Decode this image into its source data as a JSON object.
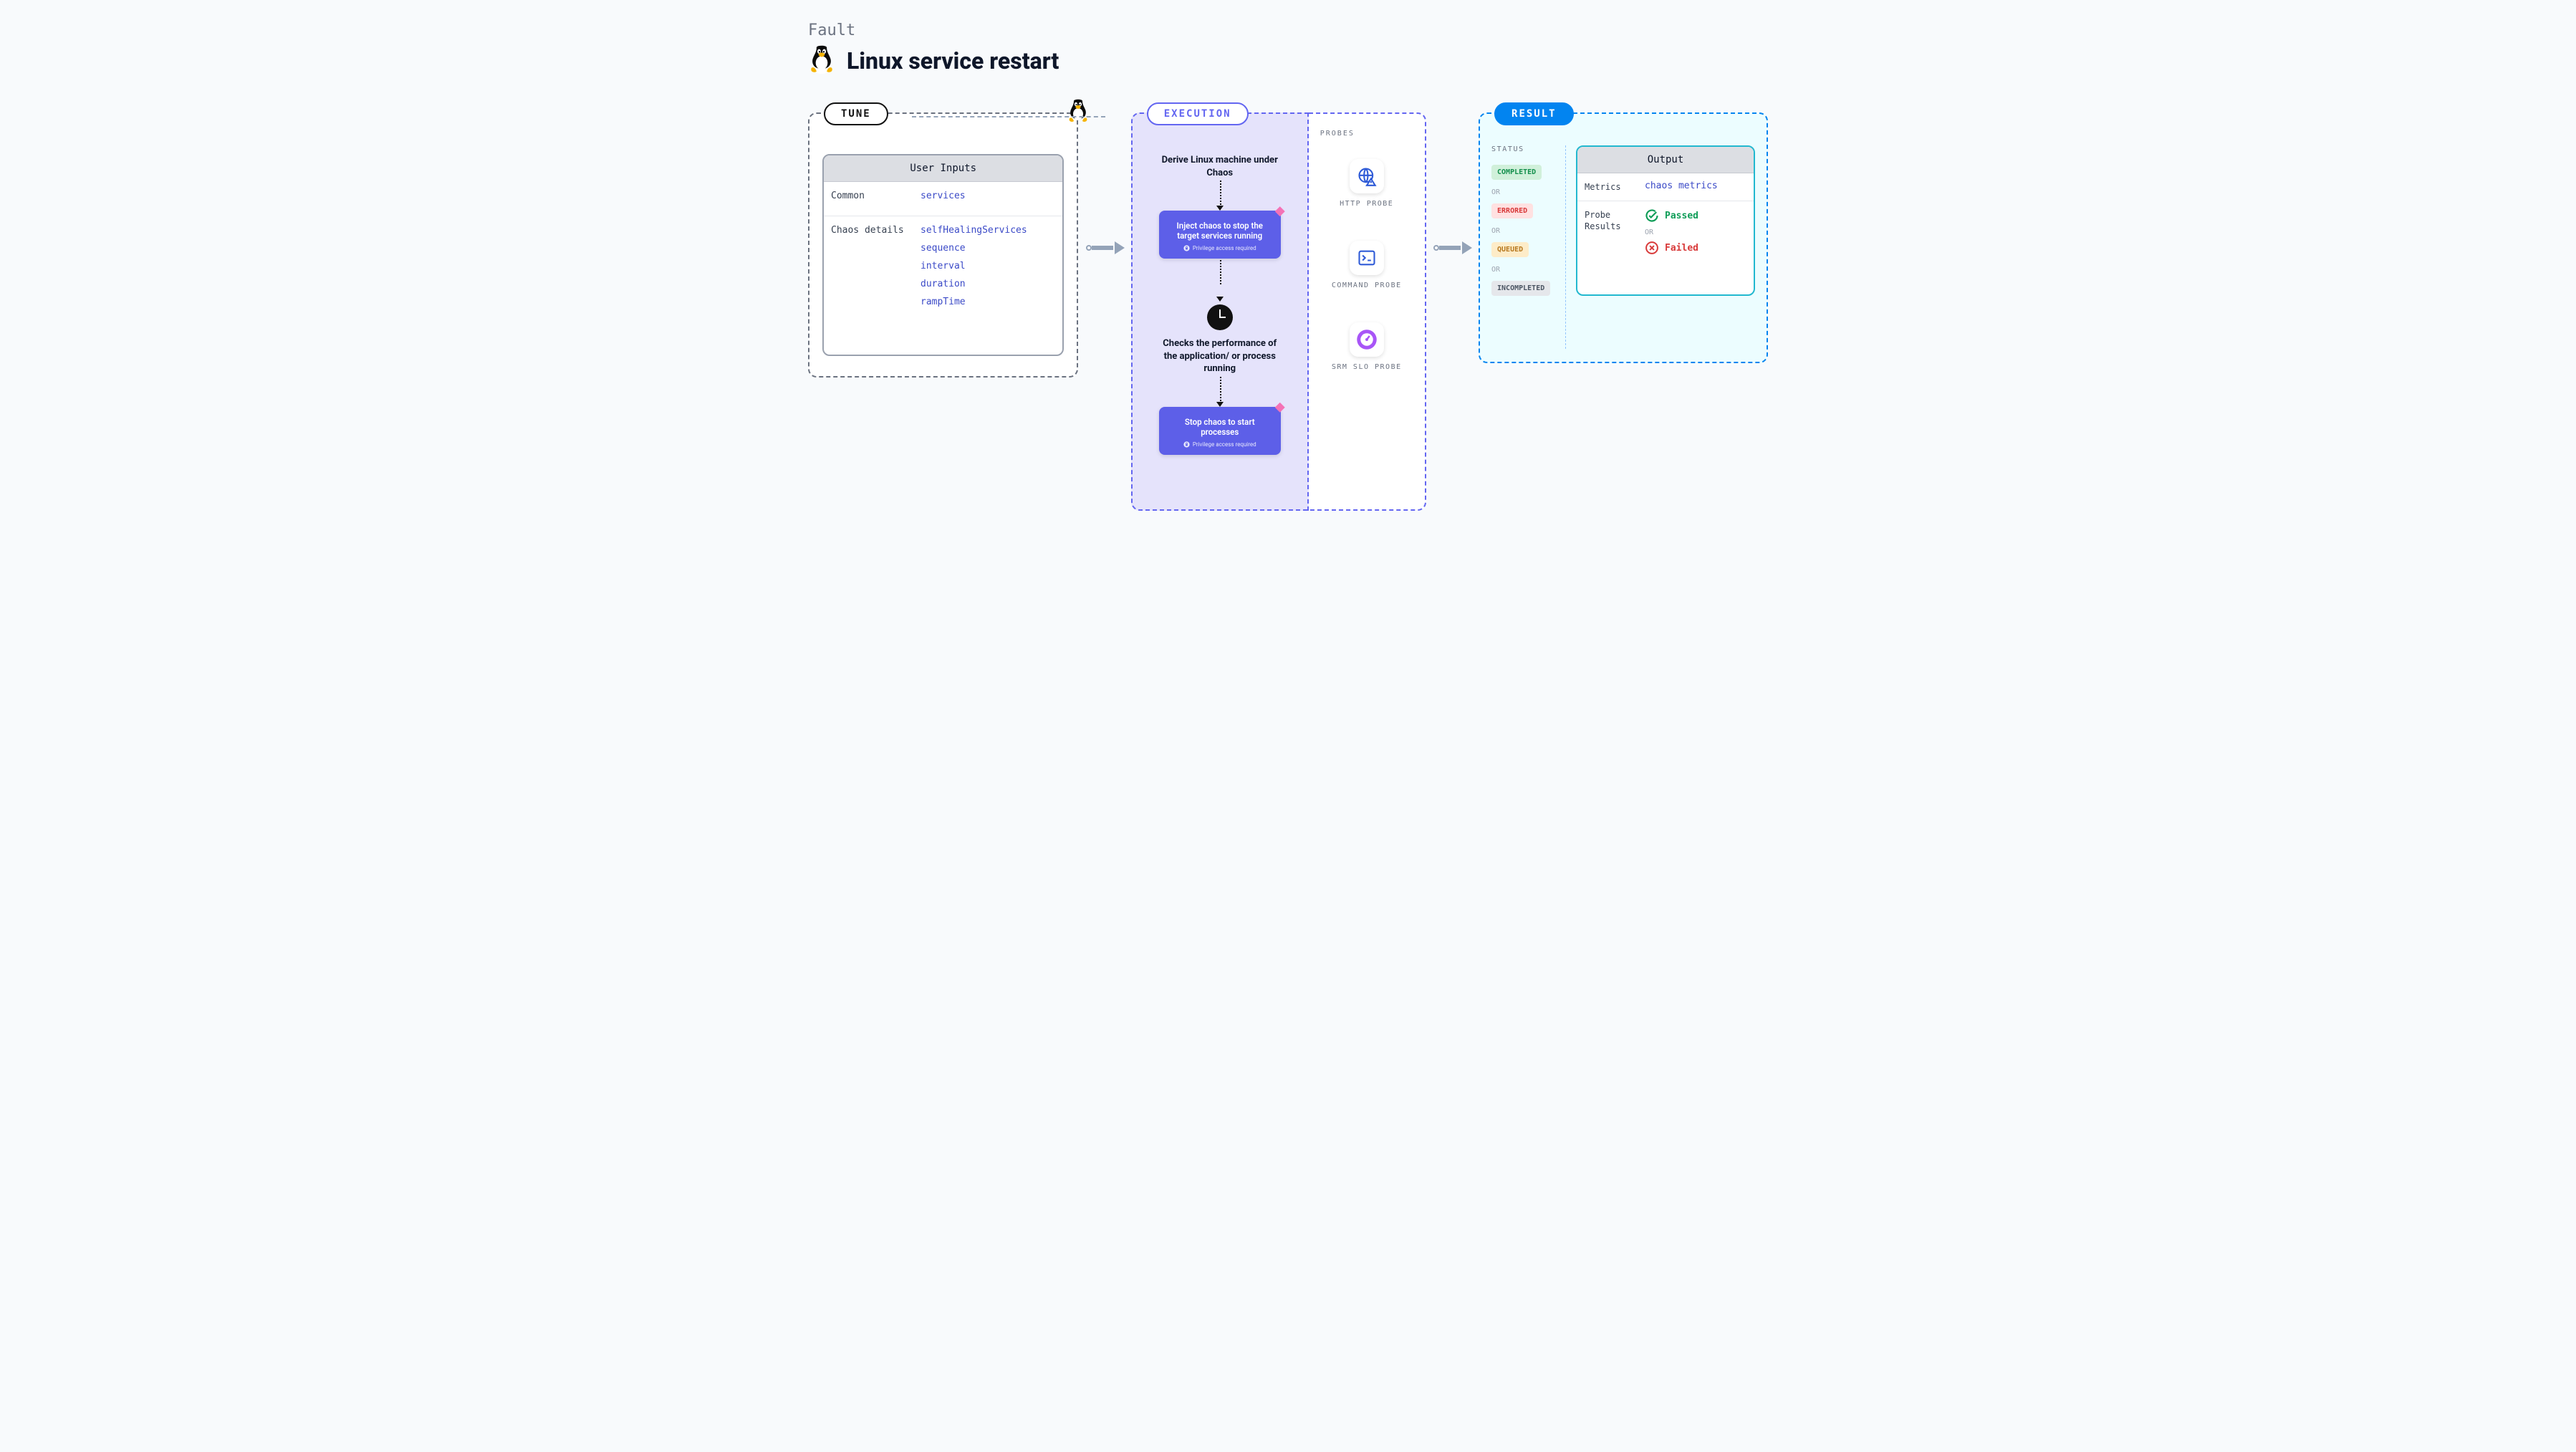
{
  "header": {
    "kicker": "Fault",
    "title": "Linux service restart"
  },
  "tags": {
    "tune": "TUNE",
    "execution": "EXECUTION",
    "result": "RESULT"
  },
  "tune": {
    "card_title": "User Inputs",
    "rows": [
      {
        "label": "Common",
        "values": [
          "services"
        ]
      },
      {
        "label": "Chaos details",
        "values": [
          "selfHealingServices",
          "sequence",
          "interval",
          "duration",
          "rampTime"
        ]
      }
    ]
  },
  "execution": {
    "step1": "Derive Linux machine under Chaos",
    "chaos1": {
      "text": "Inject chaos to stop the target services running",
      "priv": "Privilege access required"
    },
    "step2": "Checks the performance of the application/ or process running",
    "chaos2": {
      "text": "Stop chaos to start processes",
      "priv": "Privilege access required"
    }
  },
  "probes": {
    "section": "PROBES",
    "items": [
      {
        "name": "HTTP PROBE",
        "id": "http"
      },
      {
        "name": "COMMAND PROBE",
        "id": "command"
      },
      {
        "name": "SRM SLO PROBE",
        "id": "srm"
      }
    ]
  },
  "result": {
    "status_label": "STATUS",
    "statuses": [
      "COMPLETED",
      "ERRORED",
      "QUEUED",
      "INCOMPLETED"
    ],
    "or": "OR",
    "output": {
      "title": "Output",
      "metrics_label": "Metrics",
      "metrics_value": "chaos metrics",
      "probe_label": "Probe Results",
      "passed": "Passed",
      "failed": "Failed"
    }
  }
}
